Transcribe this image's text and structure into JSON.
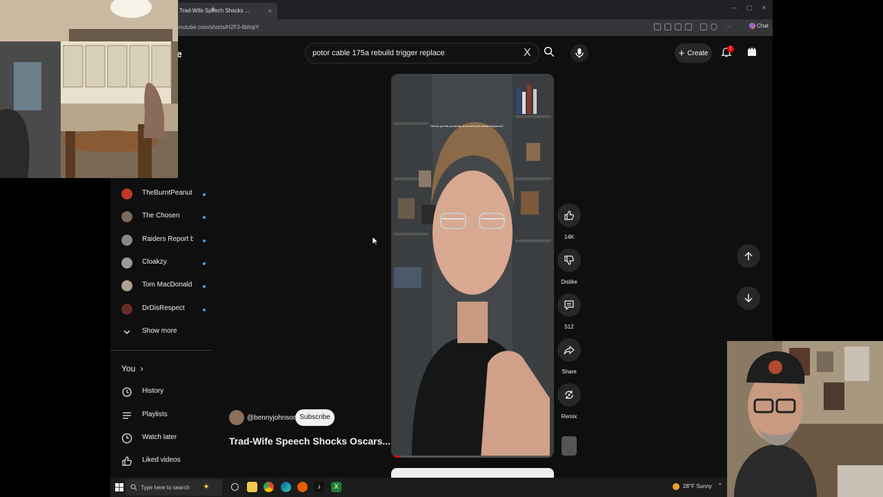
{
  "browser": {
    "tab_title": "Trad-Wife Speech Shocks ...",
    "tab_close": "×",
    "new_tab": "+",
    "url": "youtube.com/shorts/H2F3-6bhqtY",
    "chat_label": "Chat"
  },
  "youtube": {
    "logo_fragment": "e",
    "search": {
      "query": "potor cable 175a rebuild trigger replace",
      "clear": "X"
    },
    "create_label": "Create",
    "notifications_count": "1"
  },
  "sidebar": {
    "subscriptions": [
      {
        "name": "TheBurntPeanut",
        "avatar_color": "#c0392b"
      },
      {
        "name": "The Chosen",
        "avatar_color": "#7a6a5a"
      },
      {
        "name": "Raiders Report b...",
        "avatar_color": "#888888"
      },
      {
        "name": "Cloakzy",
        "avatar_color": "#9a9a9a"
      },
      {
        "name": "Tom MacDonald",
        "avatar_color": "#b0a090"
      },
      {
        "name": "DrDisRespect",
        "avatar_color": "#6b2a2a"
      }
    ],
    "show_more": "Show more",
    "you_heading": "You",
    "you_chevron": "›",
    "library": [
      {
        "label": "History",
        "icon": "history-icon"
      },
      {
        "label": "Playlists",
        "icon": "playlists-icon"
      },
      {
        "label": "Watch later",
        "icon": "watch-later-icon"
      },
      {
        "label": "Liked videos",
        "icon": "liked-videos-icon"
      }
    ]
  },
  "short": {
    "caption": "Did the pro-life pro-family movement just defeat Hollywood?",
    "channel_handle": "@bennyjohnson",
    "subscribe_label": "Subscribe",
    "title": "Trad-Wife Speech Shocks Oscars...",
    "progress": 0.05,
    "actions": {
      "like_count": "14K",
      "dislike_label": "Dislike",
      "comments_count": "512",
      "share_label": "Share",
      "remix_label": "Remix"
    }
  },
  "taskbar": {
    "search_placeholder": "Type here to search",
    "weather": "28°F  Sunny"
  },
  "colors": {
    "yt_background": "#0f0f0f",
    "accent_red": "#ff0000",
    "subscription_dot": "#3ea6ff"
  }
}
